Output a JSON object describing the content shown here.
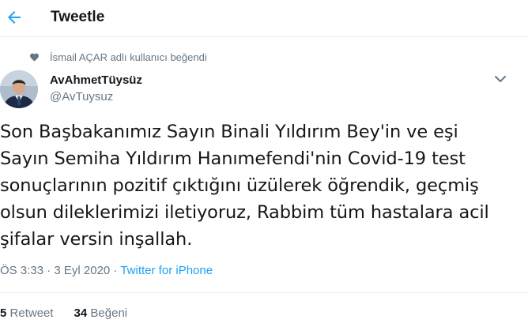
{
  "header": {
    "title": "Tweetle"
  },
  "liked_by": "İsmail AÇAR adlı kullanıcı beğendi",
  "author": {
    "name": "AvAhmetTüysüz",
    "handle": "@AvTuysuz"
  },
  "tweet": {
    "lines": [
      "Son Başbakanımız Sayın Binali Yıldırım Bey'in ve eşi",
      "Sayın Semiha Yıldırım Hanımefendi'nin Covid-19 test",
      "sonuçlarının pozitif çıktığını üzülerek öğrendik, geçmiş",
      "olsun dileklerimizi iletiyoruz, Rabbim tüm hastalara acil",
      "şifalar versin inşallah."
    ]
  },
  "meta": {
    "time": "ÖS 3:33",
    "sep": " · ",
    "date": "3 Eyl 2020",
    "source": "Twitter for iPhone"
  },
  "stats": {
    "retweet_count": "5",
    "retweet_label": "Retweet",
    "like_count": "34",
    "like_label": "Beğeni"
  },
  "colors": {
    "accent": "#1da1f2",
    "secondary_text": "#657786"
  }
}
